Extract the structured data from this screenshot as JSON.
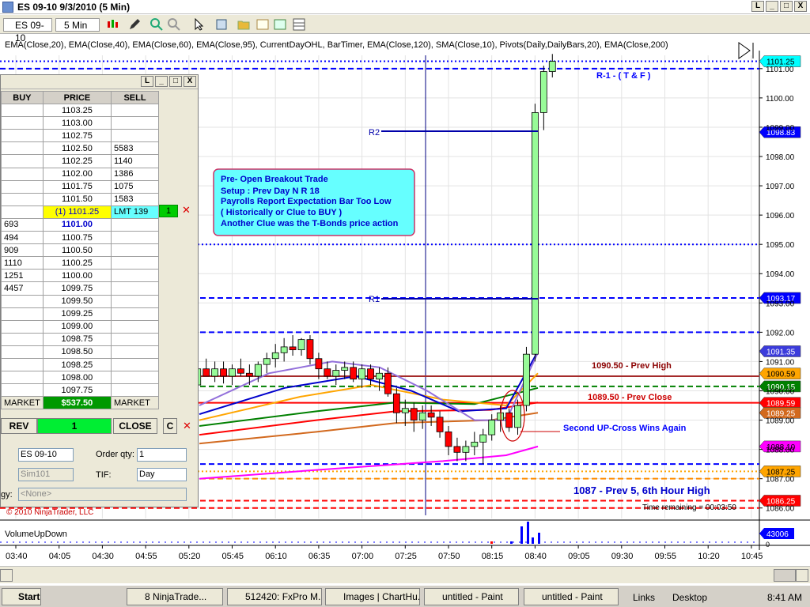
{
  "window": {
    "title": "ES 09-10  9/3/2010 (5 Min)",
    "buttons": [
      "L",
      "_",
      "□",
      "X"
    ]
  },
  "toolbar": {
    "instrument": "ES 09-10",
    "interval": "5 Min"
  },
  "indicators_label": "EMA(Close,20), EMA(Close,40), EMA(Close,60), EMA(Close,95), CurrentDayOHL, BarTimer, EMA(Close,120), SMA(Close,10), Pivots(Daily,DailyBars,20), EMA(Close,200)",
  "dom": {
    "headers": {
      "buy": "BUY",
      "price": "PRICE",
      "sell": "SELL"
    },
    "rows": [
      {
        "buy": "",
        "price": "1103.25",
        "sell": ""
      },
      {
        "buy": "",
        "price": "1103.00",
        "sell": ""
      },
      {
        "buy": "",
        "price": "1102.75",
        "sell": ""
      },
      {
        "buy": "",
        "price": "1102.50",
        "sell": "5583"
      },
      {
        "buy": "",
        "price": "1102.25",
        "sell": "1140"
      },
      {
        "buy": "",
        "price": "1102.00",
        "sell": "1386"
      },
      {
        "buy": "",
        "price": "1101.75",
        "sell": "1075"
      },
      {
        "buy": "",
        "price": "1101.50",
        "sell": "1583"
      },
      {
        "buy": "",
        "price": "(1) 1101.25",
        "sell": "LMT 139"
      },
      {
        "buy": "693",
        "price": "1101.00",
        "sell": ""
      },
      {
        "buy": "494",
        "price": "1100.75",
        "sell": ""
      },
      {
        "buy": "909",
        "price": "1100.50",
        "sell": ""
      },
      {
        "buy": "1110",
        "price": "1100.25",
        "sell": ""
      },
      {
        "buy": "1251",
        "price": "1100.00",
        "sell": ""
      },
      {
        "buy": "4457",
        "price": "1099.75",
        "sell": ""
      },
      {
        "buy": "",
        "price": "1099.50",
        "sell": ""
      },
      {
        "buy": "",
        "price": "1099.25",
        "sell": ""
      },
      {
        "buy": "",
        "price": "1099.00",
        "sell": ""
      },
      {
        "buy": "",
        "price": "1098.75",
        "sell": ""
      },
      {
        "buy": "",
        "price": "1098.50",
        "sell": ""
      },
      {
        "buy": "",
        "price": "1098.25",
        "sell": ""
      },
      {
        "buy": "",
        "price": "1098.00",
        "sell": ""
      },
      {
        "buy": "",
        "price": "1097.75",
        "sell": ""
      },
      {
        "buy": "MARKET",
        "price": "$537.50",
        "sell": "MARKET"
      }
    ],
    "position_qty": "1",
    "rev_label": "REV",
    "qty_display": "1",
    "close_label": "CLOSE",
    "c_label": "C",
    "instrument_select": "ES 09-10",
    "order_qty_label": "Order qty:",
    "order_qty": "1",
    "account_select": "Sim101",
    "tif_label": "TIF:",
    "tif_select": "Day",
    "strategy_label": "gy:",
    "strategy_select": "<None>"
  },
  "chart_data": {
    "type": "candlestick",
    "title": "ES 09-10  9/3/2010 (5 Min)",
    "x_ticks": [
      "03:40",
      "04:05",
      "04:30",
      "04:55",
      "05:20",
      "05:45",
      "06:10",
      "06:35",
      "07:00",
      "07:25",
      "07:50",
      "08:15",
      "08:40",
      "09:05",
      "09:30",
      "09:55",
      "10:20",
      "10:45"
    ],
    "y_ticks": [
      1101.0,
      1100.0,
      1099.0,
      1098.0,
      1097.0,
      1096.0,
      1095.0,
      1094.0,
      1093.0,
      1092.0,
      1091.0,
      1090.0,
      1089.0,
      1088.0,
      1087.0,
      1086.0
    ],
    "ylim": [
      1085.75,
      1101.4
    ],
    "price_tags": [
      {
        "value": "1101.25",
        "color": "#00ffff"
      },
      {
        "value": "1098.83",
        "color": "#0000ff"
      },
      {
        "value": "1093.17",
        "color": "#0000ff"
      },
      {
        "value": "1091.35",
        "color": "#3b3bdb"
      },
      {
        "value": "1090.59",
        "color": "#ffa500"
      },
      {
        "value": "1090.15",
        "color": "#008000"
      },
      {
        "value": "1089.59",
        "color": "#ff0000"
      },
      {
        "value": "1089.25",
        "color": "#d2691e"
      },
      {
        "value": "1088.10",
        "color": "#ff00ff"
      },
      {
        "value": "1087.25",
        "color": "#ffa500"
      },
      {
        "value": "1086.25",
        "color": "#ff0000"
      }
    ],
    "candles": [
      {
        "t": "05:20",
        "o": 1089.9,
        "h": 1090.4,
        "l": 1089.6,
        "c": 1090.2
      },
      {
        "t": "05:25",
        "o": 1090.2,
        "h": 1090.9,
        "l": 1090.0,
        "c": 1090.75
      },
      {
        "t": "05:30",
        "o": 1090.75,
        "h": 1091.1,
        "l": 1090.5,
        "c": 1090.5
      },
      {
        "t": "05:35",
        "o": 1090.5,
        "h": 1091.0,
        "l": 1090.3,
        "c": 1090.75
      },
      {
        "t": "05:40",
        "o": 1090.75,
        "h": 1091.0,
        "l": 1090.25,
        "c": 1090.5
      },
      {
        "t": "05:45",
        "o": 1090.5,
        "h": 1090.9,
        "l": 1090.2,
        "c": 1090.75
      },
      {
        "t": "05:50",
        "o": 1090.75,
        "h": 1091.1,
        "l": 1090.5,
        "c": 1090.6
      },
      {
        "t": "05:55",
        "o": 1090.6,
        "h": 1090.9,
        "l": 1090.2,
        "c": 1090.5
      },
      {
        "t": "06:00",
        "o": 1090.5,
        "h": 1091.0,
        "l": 1090.3,
        "c": 1090.9
      },
      {
        "t": "06:05",
        "o": 1090.9,
        "h": 1091.3,
        "l": 1090.6,
        "c": 1091.1
      },
      {
        "t": "06:10",
        "o": 1091.1,
        "h": 1091.6,
        "l": 1090.8,
        "c": 1091.3
      },
      {
        "t": "06:15",
        "o": 1091.3,
        "h": 1091.8,
        "l": 1091.0,
        "c": 1091.5
      },
      {
        "t": "06:20",
        "o": 1091.5,
        "h": 1091.9,
        "l": 1091.2,
        "c": 1091.4
      },
      {
        "t": "06:25",
        "o": 1091.4,
        "h": 1091.8,
        "l": 1091.2,
        "c": 1091.75
      },
      {
        "t": "06:30",
        "o": 1091.75,
        "h": 1091.9,
        "l": 1090.9,
        "c": 1091.1
      },
      {
        "t": "06:35",
        "o": 1091.1,
        "h": 1091.3,
        "l": 1090.4,
        "c": 1090.75
      },
      {
        "t": "06:40",
        "o": 1090.75,
        "h": 1091.0,
        "l": 1090.4,
        "c": 1090.5
      },
      {
        "t": "06:45",
        "o": 1090.5,
        "h": 1090.9,
        "l": 1090.2,
        "c": 1090.7
      },
      {
        "t": "06:50",
        "o": 1090.7,
        "h": 1091.0,
        "l": 1090.4,
        "c": 1090.8
      },
      {
        "t": "06:55",
        "o": 1090.8,
        "h": 1091.0,
        "l": 1090.3,
        "c": 1090.4
      },
      {
        "t": "07:00",
        "o": 1090.4,
        "h": 1090.9,
        "l": 1090.1,
        "c": 1090.75
      },
      {
        "t": "07:05",
        "o": 1090.75,
        "h": 1090.9,
        "l": 1090.2,
        "c": 1090.4
      },
      {
        "t": "07:10",
        "o": 1090.4,
        "h": 1090.8,
        "l": 1090.0,
        "c": 1090.6
      },
      {
        "t": "07:15",
        "o": 1090.6,
        "h": 1090.8,
        "l": 1089.8,
        "c": 1089.9
      },
      {
        "t": "07:20",
        "o": 1089.9,
        "h": 1090.1,
        "l": 1088.9,
        "c": 1089.25
      },
      {
        "t": "07:25",
        "o": 1089.25,
        "h": 1089.7,
        "l": 1088.8,
        "c": 1089.4
      },
      {
        "t": "07:30",
        "o": 1089.4,
        "h": 1089.6,
        "l": 1088.6,
        "c": 1089.0
      },
      {
        "t": "07:35",
        "o": 1089.0,
        "h": 1089.5,
        "l": 1088.7,
        "c": 1089.25
      },
      {
        "t": "07:40",
        "o": 1089.25,
        "h": 1089.5,
        "l": 1088.8,
        "c": 1089.1
      },
      {
        "t": "07:45",
        "o": 1089.1,
        "h": 1089.3,
        "l": 1088.4,
        "c": 1088.6
      },
      {
        "t": "07:50",
        "o": 1088.6,
        "h": 1088.8,
        "l": 1087.8,
        "c": 1088.1
      },
      {
        "t": "07:55",
        "o": 1088.1,
        "h": 1088.4,
        "l": 1087.6,
        "c": 1087.9
      },
      {
        "t": "08:00",
        "o": 1087.9,
        "h": 1088.3,
        "l": 1087.6,
        "c": 1088.1
      },
      {
        "t": "08:05",
        "o": 1088.1,
        "h": 1088.6,
        "l": 1087.8,
        "c": 1088.25
      },
      {
        "t": "08:10",
        "o": 1088.25,
        "h": 1088.7,
        "l": 1087.5,
        "c": 1088.5
      },
      {
        "t": "08:15",
        "o": 1088.5,
        "h": 1089.2,
        "l": 1088.3,
        "c": 1089.0
      },
      {
        "t": "08:20",
        "o": 1089.0,
        "h": 1089.5,
        "l": 1088.6,
        "c": 1089.25
      },
      {
        "t": "08:25",
        "o": 1089.25,
        "h": 1089.4,
        "l": 1088.6,
        "c": 1088.75
      },
      {
        "t": "08:30",
        "o": 1088.75,
        "h": 1089.7,
        "l": 1088.5,
        "c": 1089.5
      },
      {
        "t": "08:35",
        "o": 1089.5,
        "h": 1091.5,
        "l": 1089.3,
        "c": 1091.25
      },
      {
        "t": "08:40",
        "o": 1091.25,
        "h": 1099.8,
        "l": 1091.0,
        "c": 1099.5
      },
      {
        "t": "08:45",
        "o": 1099.5,
        "h": 1101.1,
        "l": 1098.9,
        "c": 1100.9
      },
      {
        "t": "08:50",
        "o": 1100.9,
        "h": 1101.5,
        "l": 1100.7,
        "c": 1101.25
      }
    ],
    "horizontal_lines": [
      {
        "value": 1101.25,
        "color": "#0000ff",
        "style": "dotted"
      },
      {
        "value": 1101.0,
        "color": "#0000ff",
        "style": "dashed"
      },
      {
        "value": 1095.0,
        "color": "#0000ff",
        "style": "dotted"
      },
      {
        "value": 1093.17,
        "color": "#0000ff",
        "style": "dashed"
      },
      {
        "value": 1092.0,
        "color": "#0000ff",
        "style": "dashed"
      },
      {
        "value": 1090.5,
        "color": "#a52a2a",
        "style": "solid"
      },
      {
        "value": 1090.15,
        "color": "#008000",
        "style": "dashed"
      },
      {
        "value": 1089.59,
        "color": "#ff0000",
        "style": "solid"
      },
      {
        "value": 1087.5,
        "color": "#0000ff",
        "style": "dashed"
      },
      {
        "value": 1087.25,
        "color": "#ffa500",
        "style": "dotted"
      },
      {
        "value": 1087.0,
        "color": "#ff8c00",
        "style": "dashed"
      },
      {
        "value": 1086.25,
        "color": "#ff0000",
        "style": "dashed"
      },
      {
        "value": 1086.0,
        "color": "#ff0000",
        "style": "dashed"
      }
    ],
    "annotations": {
      "r1_label": "R-1 - ( T & F )",
      "r2_label": "R2",
      "r1_short": "R1",
      "prev_high": "1090.50 - Prev High",
      "prev_close": "1089.50 - Prev Close",
      "up_cross": "Second UP-Cross Wins Again",
      "prev5": "1087 - Prev 5, 6th Hour High",
      "time_remaining": "Time remaining = 00:03:50",
      "copyright": "© 2010 NinjaTrader, LLC",
      "note_lines": [
        "Pre- Open Breakout Trade",
        "Setup : Prev Day N R 18",
        "Payrolls Report Expectation Bar Too Low",
        " ( Historically or Clue  to BUY )",
        "Another Clue was the T-Bonds price action"
      ]
    },
    "volume_panel": {
      "label": "VolumeUpDown",
      "tag": "43006",
      "axis_min": "0"
    }
  },
  "taskbar": {
    "start": "Start",
    "tasks": [
      "8 NinjaTrade...",
      "512420: FxPro M...",
      "Images | ChartHu...",
      "untitled - Paint",
      "untitled - Paint"
    ],
    "links": "Links",
    "desktop": "Desktop",
    "time": "8:41 AM"
  }
}
